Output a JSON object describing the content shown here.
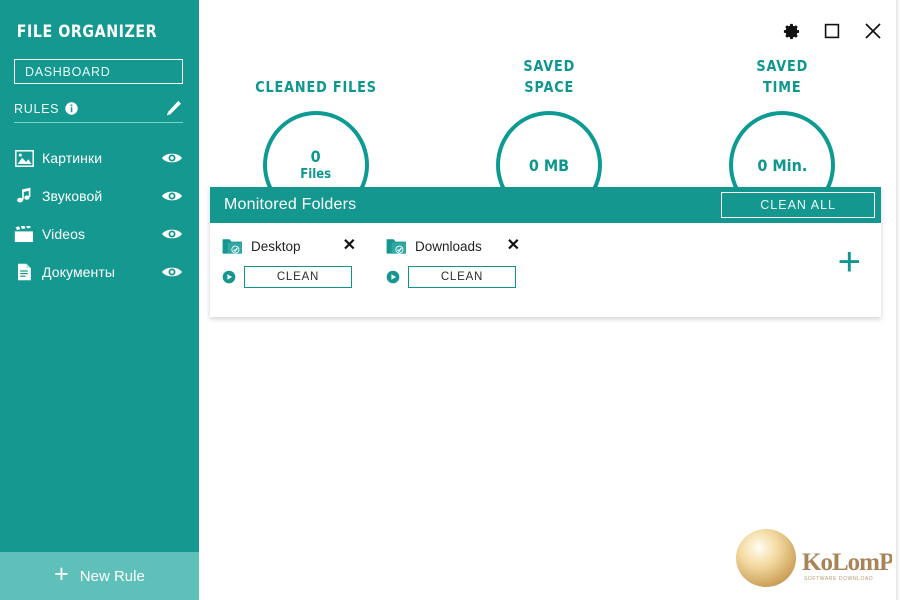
{
  "window": {
    "controls": [
      {
        "name": "settings",
        "label": "Settings",
        "icon": "gear-icon"
      },
      {
        "name": "maximize",
        "label": "Maximize",
        "icon": "maximize-icon"
      },
      {
        "name": "close",
        "label": "Close",
        "icon": "close-icon"
      }
    ]
  },
  "sidebar": {
    "app_title": "FILE ORGANIZER",
    "dashboard_label": "DASHBOARD",
    "rules_label": "RULES",
    "rules_info_icon": "info-icon",
    "rules_edit_icon": "pencil-icon",
    "rules": [
      {
        "label": "Картинки",
        "icon": "image-icon",
        "toggle_icon": "eye-icon"
      },
      {
        "label": "Звуковой",
        "icon": "music-icon",
        "toggle_icon": "eye-icon"
      },
      {
        "label": "Videos",
        "icon": "video-icon",
        "toggle_icon": "eye-icon"
      },
      {
        "label": "Документы",
        "icon": "document-icon",
        "toggle_icon": "eye-icon"
      }
    ],
    "new_rule_label": "New Rule",
    "new_rule_icon": "plus-icon"
  },
  "stats": [
    {
      "title": "CLEANED FILES",
      "value": "0",
      "unit": "Files"
    },
    {
      "title": "SAVED\nSPACE",
      "value": "0 MB",
      "unit": ""
    },
    {
      "title": "SAVED\nTIME",
      "value": "0 Min.",
      "unit": ""
    }
  ],
  "stats_titles": {
    "cleaned_files": "CLEANED FILES",
    "saved_space_line1": "SAVED",
    "saved_space_line2": "SPACE",
    "saved_time_line1": "SAVED",
    "saved_time_line2": "TIME"
  },
  "stats_values": {
    "cleaned_files_value": "0",
    "cleaned_files_unit": "Files",
    "saved_space_value": "0 MB",
    "saved_time_value": "0 Min."
  },
  "folders_panel": {
    "title": "Monitored Folders",
    "clean_all_label": "CLEAN ALL",
    "add_icon": "plus-icon",
    "items": [
      {
        "name": "Desktop",
        "clean_label": "CLEAN",
        "folder_icon": "folder-check-icon",
        "run_icon": "play-icon",
        "remove_icon": "close-icon"
      },
      {
        "name": "Downloads",
        "clean_label": "CLEAN",
        "folder_icon": "folder-check-icon",
        "run_icon": "play-icon",
        "remove_icon": "close-icon"
      }
    ]
  },
  "watermark": {
    "text": "KoLomPC",
    "icon": "sphere-icon"
  },
  "colors": {
    "brand_teal": "#14988f",
    "header_teal": "#13978f",
    "ring_teal": "#0d9a93",
    "text_teal": "#0e968f",
    "footer_teal": "#5ec0b9",
    "panel_white": "#ffffff"
  }
}
